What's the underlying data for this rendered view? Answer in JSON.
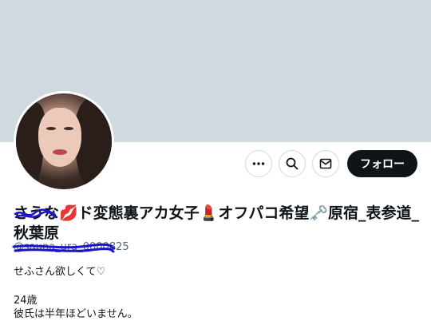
{
  "header": {
    "banner_color": "#cfd9de"
  },
  "profile": {
    "avatar_icon": "profile-photo",
    "display_name": "さうな💋ド変態裏アカ女子💄オフパコ希望🗝️原宿_表参道_秋葉原",
    "handle": "@sauna_ura_0000825",
    "bio_lines": [
      "せふさん欲しくて♡",
      "",
      "24歳",
      "彼氏は半年ほどいません。"
    ]
  },
  "actions": {
    "more_icon": "more-icon",
    "search_icon": "search-icon",
    "message_icon": "mail-icon",
    "follow_label": "フォロー"
  },
  "colors": {
    "accent": "#0f1419",
    "secondary_text": "#536471",
    "scribble": "#1a14c8"
  }
}
